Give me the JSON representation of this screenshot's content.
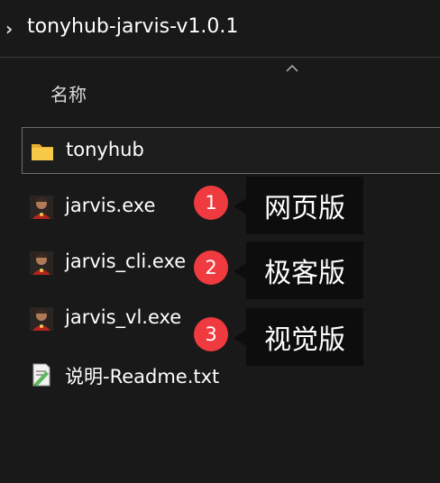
{
  "breadcrumb": {
    "chevron": "›",
    "title": "tonyhub-jarvis-v1.0.1"
  },
  "column_header": {
    "name": "名称"
  },
  "files": [
    {
      "name": "tonyhub",
      "icon": "folder-icon"
    },
    {
      "name": "jarvis.exe",
      "icon": "ironman-app-icon"
    },
    {
      "name": "jarvis_cli.exe",
      "icon": "ironman-app-icon"
    },
    {
      "name": "jarvis_vl.exe",
      "icon": "ironman-app-icon"
    },
    {
      "name": "说明-Readme.txt",
      "icon": "text-file-icon"
    }
  ],
  "annotations": [
    {
      "number": "1",
      "label": "网页版"
    },
    {
      "number": "2",
      "label": "极客版"
    },
    {
      "number": "3",
      "label": "视觉版"
    }
  ],
  "colors": {
    "background": "#191919",
    "badge": "#ef3a3f",
    "callout": "#0d0d0d",
    "folder": "#f5c242"
  }
}
